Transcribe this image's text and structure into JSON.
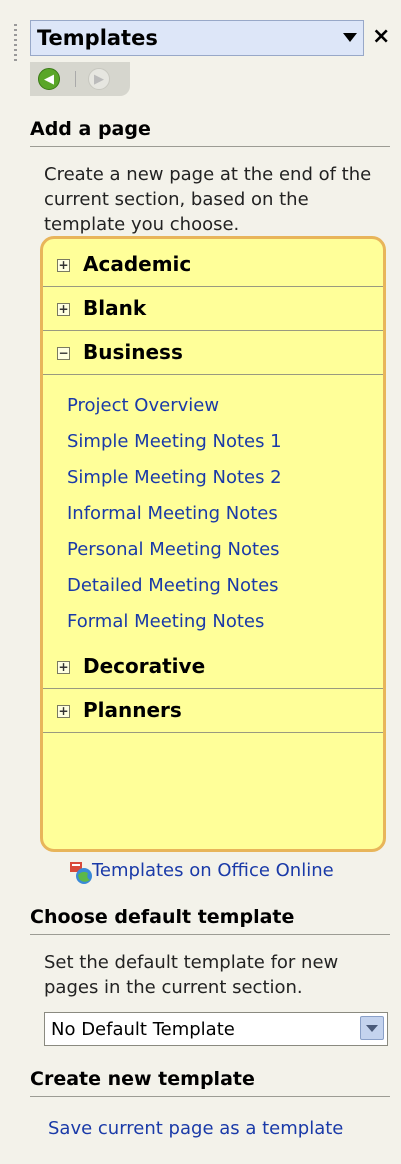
{
  "panel": {
    "title": "Templates"
  },
  "add_page": {
    "heading": "Add a page",
    "description": "Create a new page at the end of the current section, based on the template you choose."
  },
  "gallery": {
    "categories": [
      {
        "label": "Academic",
        "expander": "+"
      },
      {
        "label": "Blank",
        "expander": "+"
      },
      {
        "label": "Business",
        "expander": "−"
      },
      {
        "label": "Decorative",
        "expander": "+"
      },
      {
        "label": "Planners",
        "expander": "+"
      }
    ],
    "business_templates": [
      "Project Overview",
      "Simple Meeting Notes 1",
      "Simple Meeting Notes 2",
      "Informal Meeting Notes",
      "Personal Meeting Notes",
      "Detailed Meeting Notes",
      "Formal Meeting Notes"
    ]
  },
  "online_link": "Templates on Office Online",
  "default_template": {
    "heading": "Choose default template",
    "description": "Set the default template for new pages in the current section.",
    "selected": "No Default Template"
  },
  "create_template": {
    "heading": "Create new template",
    "save_link": "Save current page as a template"
  },
  "colors": {
    "gallery_bg": "#ffff99",
    "gallery_border": "#e8b55a",
    "link": "#1a3aa8"
  },
  "icons": [
    "back-icon",
    "forward-icon",
    "close-icon",
    "office-online-icon",
    "dropdown-arrow-icon"
  ]
}
